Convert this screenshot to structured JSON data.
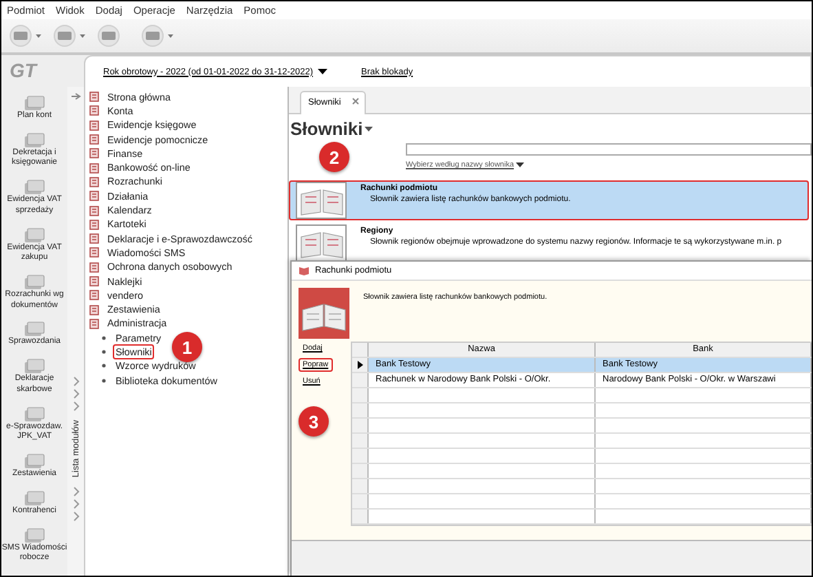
{
  "menu": [
    "Podmiot",
    "Widok",
    "Dodaj",
    "Operacje",
    "Narzędzia",
    "Pomoc"
  ],
  "logo": "GT",
  "period_link": "Rok obrotowy - 2022  (od 01-01-2022 do 31-12-2022)",
  "lock_status": "Brak blokady",
  "modules": [
    {
      "label": "Plan kont"
    },
    {
      "label": "Dekretacja i księgowanie"
    },
    {
      "label": "Ewidencja VAT sprzedaży"
    },
    {
      "label": "Ewidencja VAT zakupu"
    },
    {
      "label": "Rozrachunki wg dokumentów"
    },
    {
      "label": "Sprawozdania"
    },
    {
      "label": "Deklaracje skarbowe"
    },
    {
      "label": "e-Sprawozdaw. JPK_VAT"
    },
    {
      "label": "Zestawienia"
    },
    {
      "label": "Kontrahenci"
    },
    {
      "label": "SMS Wiadomości robocze"
    }
  ],
  "side_panel_label": "Lista modułów",
  "tree": [
    {
      "label": "Strona główna",
      "selected": false
    },
    {
      "label": "Konta",
      "selected": false
    },
    {
      "label": "Ewidencje księgowe",
      "selected": false
    },
    {
      "label": "Ewidencje pomocnicze",
      "selected": false
    },
    {
      "label": "Finanse",
      "selected": false
    },
    {
      "label": "Bankowość on-line",
      "selected": false
    },
    {
      "label": "Rozrachunki",
      "selected": false
    },
    {
      "label": "Działania",
      "selected": false
    },
    {
      "label": "Kalendarz",
      "selected": false
    },
    {
      "label": "Kartoteki",
      "selected": false
    },
    {
      "label": "Deklaracje i e-Sprawozdawczość",
      "selected": false
    },
    {
      "label": "Wiadomości SMS",
      "selected": false
    },
    {
      "label": "Ochrona danych osobowych",
      "selected": false
    },
    {
      "label": "Naklejki",
      "selected": false
    },
    {
      "label": "vendero",
      "selected": false
    },
    {
      "label": "Zestawienia",
      "selected": false
    },
    {
      "label": "Administracja",
      "selected": false,
      "children": [
        {
          "label": "Parametry",
          "selected": false
        },
        {
          "label": "Słowniki",
          "selected": true
        },
        {
          "label": "Wzorce wydruków",
          "selected": false
        },
        {
          "label": "Biblioteka dokumentów",
          "selected": false
        }
      ]
    }
  ],
  "tabs": [
    {
      "label": "Słowniki",
      "selected": true
    }
  ],
  "heading": "Słowniki",
  "filter_link": "Wybierz według nazwy słownika",
  "dictionaries": [
    {
      "title": "Rachunki podmiotu",
      "description": "Słownik zawiera listę rachunków bankowych podmiotu.",
      "selected": true
    },
    {
      "title": "Regiony",
      "description": "Słownik regionów obejmuje wprowadzone do systemu nazwy regionów. Informacje te są wykorzystywane m.in. p",
      "selected": false
    }
  ],
  "dialog": {
    "title": "Rachunki podmiotu",
    "description": "Słownik zawiera listę rachunków bankowych podmiotu.",
    "actions": [
      {
        "label": "Dodaj",
        "selected": false
      },
      {
        "label": "Popraw",
        "selected": true
      },
      {
        "label": "Usuń",
        "selected": false
      }
    ],
    "table": {
      "columns": [
        "Nazwa",
        "Bank"
      ],
      "rows": [
        {
          "cells": [
            "Bank Testowy",
            "Bank Testowy"
          ],
          "selected": true
        },
        {
          "cells": [
            "Rachunek w Narodowy Bank Polski  - O/Okr.",
            "Narodowy Bank Polski  - O/Okr. w Warszawi"
          ],
          "selected": false
        }
      ]
    }
  },
  "callouts": [
    "1",
    "2",
    "3"
  ]
}
